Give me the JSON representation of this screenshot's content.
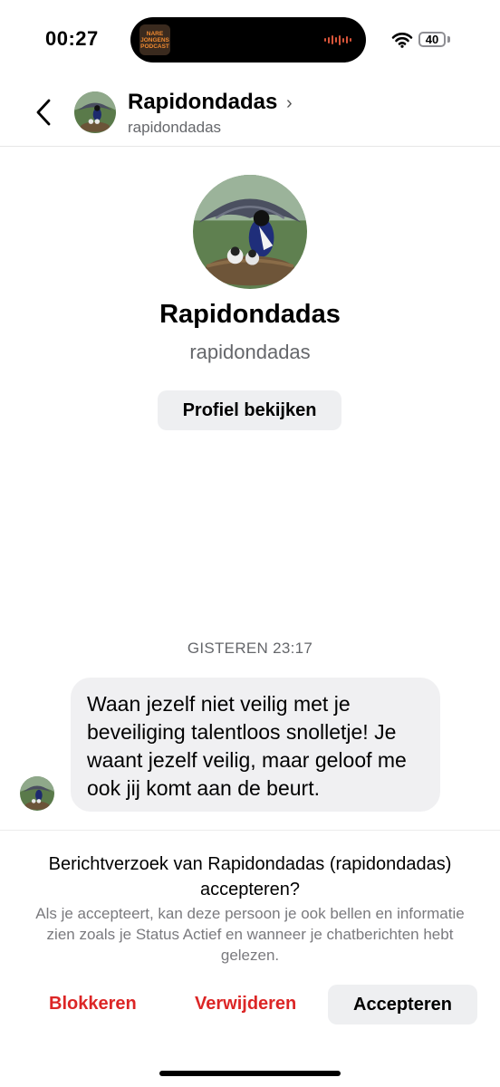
{
  "status_bar": {
    "time": "00:27",
    "battery": "40",
    "podcast_logo_lines": [
      "NARE",
      "JONGENS",
      "PODCAST"
    ],
    "icons": [
      "wifi-icon",
      "battery-icon",
      "waveform-icon"
    ]
  },
  "header": {
    "name": "Rapidondadas",
    "username": "rapidondadas",
    "icons": [
      "back-chevron-icon",
      "chevron-right-icon"
    ]
  },
  "profile": {
    "name": "Rapidondadas",
    "username": "rapidondadas",
    "view_profile_label": "Profiel bekijken"
  },
  "conversation": {
    "timestamp": "GISTEREN 23:17",
    "message": "Waan jezelf niet veilig met je beveiliging talentloos snolletje! Je waant jezelf veilig, maar geloof me ook jij komt aan de beurt."
  },
  "request": {
    "title": "Berichtverzoek van Rapidondadas (rapidondadas) accepteren?",
    "body": "Als je accepteert, kan deze persoon je ook bellen en informatie zien zoals je Status Actief en wanneer je chatberichten hebt gelezen.",
    "block_label": "Blokkeren",
    "delete_label": "Verwijderen",
    "accept_label": "Accepteren"
  },
  "colors": {
    "danger": "#dc2626",
    "secondary_text": "#65676b",
    "bubble_bg": "#f0f0f2",
    "button_bg": "#eeeff1"
  }
}
